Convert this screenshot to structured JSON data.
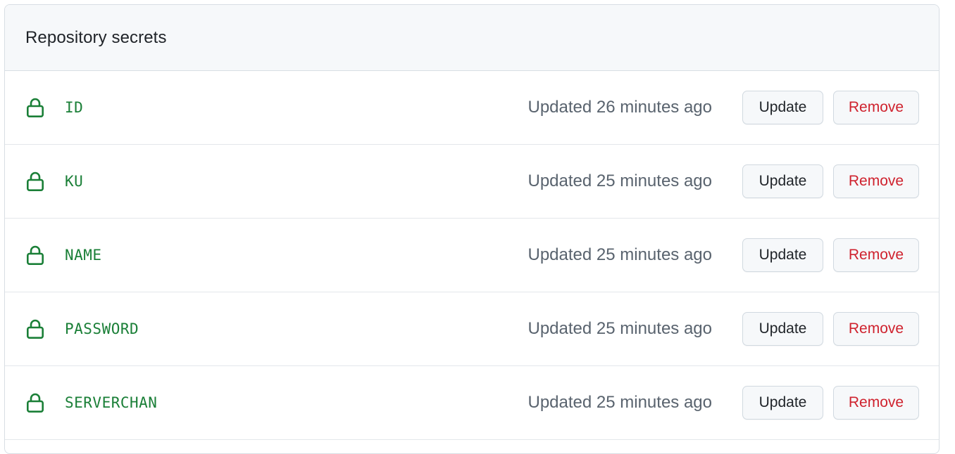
{
  "panel": {
    "title": "Repository secrets"
  },
  "secrets": [
    {
      "name": "ID",
      "updated": "Updated 26 minutes ago",
      "update_label": "Update",
      "remove_label": "Remove"
    },
    {
      "name": "KU",
      "updated": "Updated 25 minutes ago",
      "update_label": "Update",
      "remove_label": "Remove"
    },
    {
      "name": "NAME",
      "updated": "Updated 25 minutes ago",
      "update_label": "Update",
      "remove_label": "Remove"
    },
    {
      "name": "PASSWORD",
      "updated": "Updated 25 minutes ago",
      "update_label": "Update",
      "remove_label": "Remove"
    },
    {
      "name": "SERVERCHAN",
      "updated": "Updated 25 minutes ago",
      "update_label": "Update",
      "remove_label": "Remove"
    }
  ],
  "icons": {
    "secret": "lock-icon"
  },
  "colors": {
    "secret_name": "#1a7f37",
    "remove_text": "#cf222e",
    "header_bg": "#f6f8fa",
    "muted_text": "#59636e"
  }
}
